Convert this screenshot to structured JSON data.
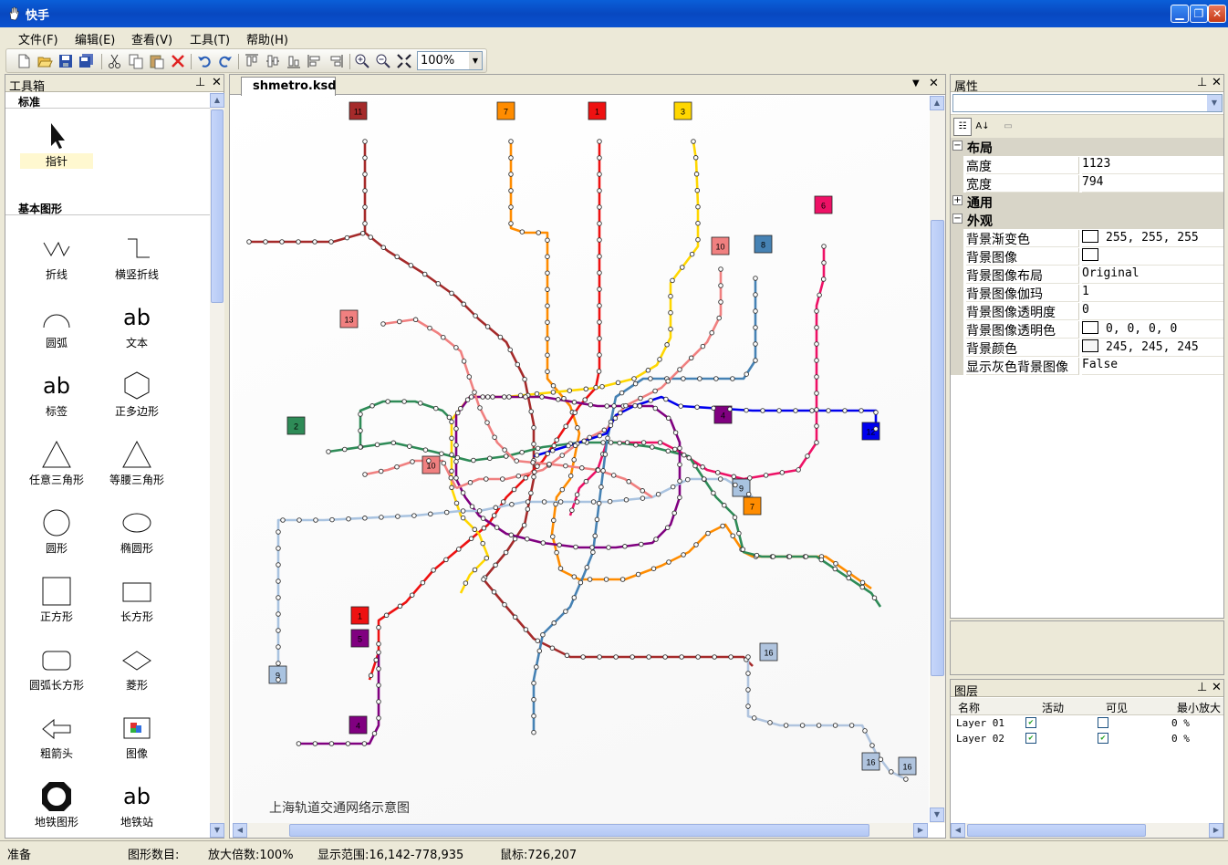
{
  "window": {
    "title": "快手"
  },
  "menubar": [
    {
      "label": "文件(F)"
    },
    {
      "label": "编辑(E)"
    },
    {
      "label": "查看(V)"
    },
    {
      "label": "工具(T)"
    },
    {
      "label": "帮助(H)"
    }
  ],
  "toolbar": {
    "zoom_value": "100%",
    "icons": [
      "new-icon",
      "open-icon",
      "save-icon",
      "save-all-icon",
      "cut-icon",
      "copy-icon",
      "paste-icon",
      "delete-icon",
      "undo-icon",
      "redo-icon",
      "align-top-icon",
      "align-middle-icon",
      "align-bottom-icon",
      "align-left-icon",
      "align-right-icon",
      "zoom-in-icon",
      "zoom-out-icon",
      "fit-icon"
    ]
  },
  "toolbox": {
    "title": "工具箱",
    "section_standard": "标准",
    "section_basic": "基本图形",
    "pointer": "指针",
    "tools": [
      {
        "label": "折线",
        "icon": "polyline-icon"
      },
      {
        "label": "横竖折线",
        "icon": "orthogonal-polyline-icon"
      },
      {
        "label": "圆弧",
        "icon": "arc-icon"
      },
      {
        "label": "文本",
        "icon": "text-icon",
        "glyph": "ab"
      },
      {
        "label": "标签",
        "icon": "label-icon",
        "glyph": "ab"
      },
      {
        "label": "正多边形",
        "icon": "hexagon-icon"
      },
      {
        "label": "任意三角形",
        "icon": "triangle-icon"
      },
      {
        "label": "等腰三角形",
        "icon": "isosceles-triangle-icon"
      },
      {
        "label": "圆形",
        "icon": "circle-icon"
      },
      {
        "label": "椭圆形",
        "icon": "ellipse-icon"
      },
      {
        "label": "正方形",
        "icon": "square-icon"
      },
      {
        "label": "长方形",
        "icon": "rectangle-icon"
      },
      {
        "label": "圆弧长方形",
        "icon": "rounded-rectangle-icon"
      },
      {
        "label": "菱形",
        "icon": "diamond-icon"
      },
      {
        "label": "粗箭头",
        "icon": "thick-arrow-icon"
      },
      {
        "label": "图像",
        "icon": "image-icon"
      },
      {
        "label": "地铁图形",
        "icon": "metro-shape-icon"
      },
      {
        "label": "地铁站",
        "icon": "metro-station-icon",
        "glyph": "ab"
      }
    ]
  },
  "document": {
    "tab": "shmetro.ksd",
    "map_title": "上海轨道交通网络示意图",
    "line_badges": [
      {
        "num": "11",
        "color": "#a52a2a"
      },
      {
        "num": "7",
        "color": "#ff8c00"
      },
      {
        "num": "1",
        "color": "#ee1111"
      },
      {
        "num": "3",
        "color": "#ffd700"
      },
      {
        "num": "6",
        "color": "#ee1166"
      },
      {
        "num": "10",
        "color": "#f08080"
      },
      {
        "num": "8",
        "color": "#4682b4"
      },
      {
        "num": "13",
        "color": "#f08080"
      },
      {
        "num": "2",
        "color": "#2e8b57"
      },
      {
        "num": "4",
        "color": "#800080"
      },
      {
        "num": "5",
        "color": "#800080"
      },
      {
        "num": "9",
        "color": "#a9c3e0"
      },
      {
        "num": "12",
        "color": "#0000ee"
      },
      {
        "num": "16",
        "color": "#b0c4de"
      }
    ]
  },
  "properties": {
    "title": "属性",
    "categories": {
      "layout": "布局",
      "general": "通用",
      "appearance": "外观"
    },
    "layout_rows": [
      {
        "name": "高度",
        "value": "1123"
      },
      {
        "name": "宽度",
        "value": "794"
      }
    ],
    "appearance_rows": [
      {
        "name": "背景渐变色",
        "value": "255, 255, 255",
        "swatch": "#ffffff"
      },
      {
        "name": "背景图像",
        "value": "",
        "swatch": "#ffffff"
      },
      {
        "name": "背景图像布局",
        "value": "Original"
      },
      {
        "name": "背景图像伽玛",
        "value": "1"
      },
      {
        "name": "背景图像透明度",
        "value": "0"
      },
      {
        "name": "背景图像透明色",
        "value": "0, 0, 0, 0",
        "swatch": "#ffffff"
      },
      {
        "name": "背景颜色",
        "value": "245, 245, 245",
        "swatch": "#f5f5f5"
      },
      {
        "name": "显示灰色背景图像",
        "value": "False"
      }
    ]
  },
  "layers": {
    "title": "图层",
    "columns": [
      "名称",
      "活动",
      "可见",
      "最小放大"
    ],
    "rows": [
      {
        "name": "Layer 01",
        "active": true,
        "visible": false,
        "min_zoom": "0 %"
      },
      {
        "name": "Layer 02",
        "active": true,
        "visible": true,
        "min_zoom": "0 %"
      }
    ]
  },
  "statusbar": {
    "ready": "准备",
    "shape_count": "图形数目:",
    "zoom": "放大倍数:100%",
    "range": "显示范围:16,142-778,935",
    "mouse": "鼠标:726,207"
  }
}
